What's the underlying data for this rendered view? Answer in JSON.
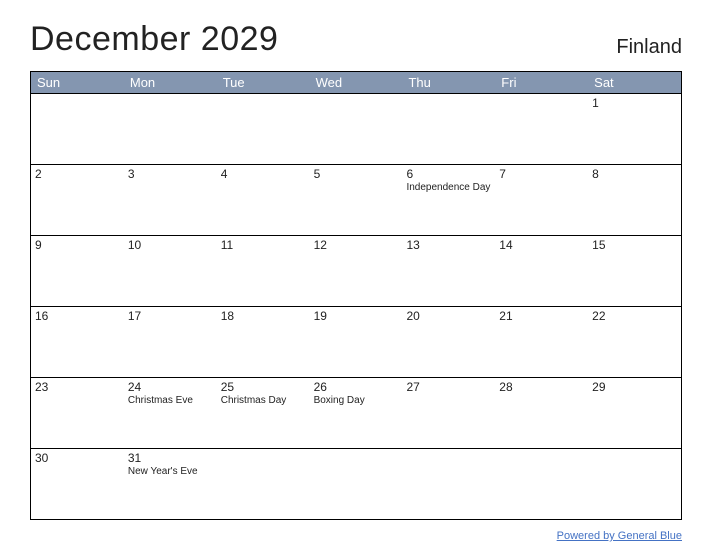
{
  "title": "December 2029",
  "country": "Finland",
  "day_headers": [
    "Sun",
    "Mon",
    "Tue",
    "Wed",
    "Thu",
    "Fri",
    "Sat"
  ],
  "weeks": [
    [
      {
        "num": "",
        "event": ""
      },
      {
        "num": "",
        "event": ""
      },
      {
        "num": "",
        "event": ""
      },
      {
        "num": "",
        "event": ""
      },
      {
        "num": "",
        "event": ""
      },
      {
        "num": "",
        "event": ""
      },
      {
        "num": "1",
        "event": ""
      }
    ],
    [
      {
        "num": "2",
        "event": ""
      },
      {
        "num": "3",
        "event": ""
      },
      {
        "num": "4",
        "event": ""
      },
      {
        "num": "5",
        "event": ""
      },
      {
        "num": "6",
        "event": "Independence Day"
      },
      {
        "num": "7",
        "event": ""
      },
      {
        "num": "8",
        "event": ""
      }
    ],
    [
      {
        "num": "9",
        "event": ""
      },
      {
        "num": "10",
        "event": ""
      },
      {
        "num": "11",
        "event": ""
      },
      {
        "num": "12",
        "event": ""
      },
      {
        "num": "13",
        "event": ""
      },
      {
        "num": "14",
        "event": ""
      },
      {
        "num": "15",
        "event": ""
      }
    ],
    [
      {
        "num": "16",
        "event": ""
      },
      {
        "num": "17",
        "event": ""
      },
      {
        "num": "18",
        "event": ""
      },
      {
        "num": "19",
        "event": ""
      },
      {
        "num": "20",
        "event": ""
      },
      {
        "num": "21",
        "event": ""
      },
      {
        "num": "22",
        "event": ""
      }
    ],
    [
      {
        "num": "23",
        "event": ""
      },
      {
        "num": "24",
        "event": "Christmas Eve"
      },
      {
        "num": "25",
        "event": "Christmas Day"
      },
      {
        "num": "26",
        "event": "Boxing Day"
      },
      {
        "num": "27",
        "event": ""
      },
      {
        "num": "28",
        "event": ""
      },
      {
        "num": "29",
        "event": ""
      }
    ],
    [
      {
        "num": "30",
        "event": ""
      },
      {
        "num": "31",
        "event": "New Year's Eve"
      },
      {
        "num": "",
        "event": ""
      },
      {
        "num": "",
        "event": ""
      },
      {
        "num": "",
        "event": ""
      },
      {
        "num": "",
        "event": ""
      },
      {
        "num": "",
        "event": ""
      }
    ]
  ],
  "footer_link": "Powered by General Blue"
}
